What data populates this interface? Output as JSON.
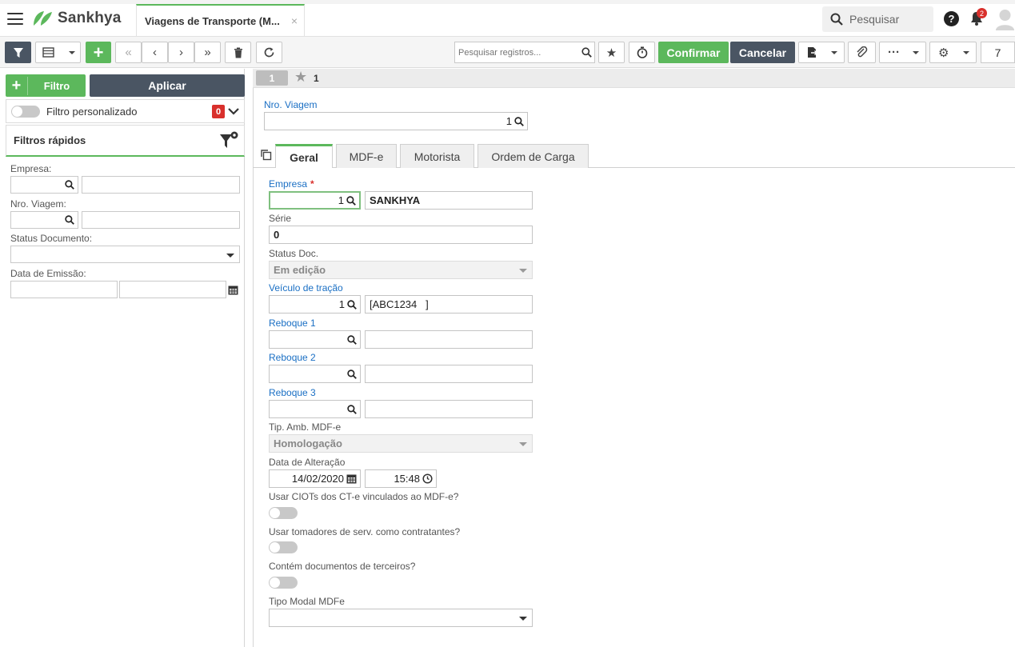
{
  "app": {
    "brand": "Sankhya",
    "tab_title": "Viagens de Transporte (M...",
    "tab_close": "×",
    "search_label": "Pesquisar",
    "notifications_count": "2",
    "help": "?"
  },
  "toolbar": {
    "search_placeholder": "Pesquisar registros...",
    "confirm_label": "Confirmar",
    "cancel_label": "Cancelar",
    "more_label": "···",
    "page_number": "7"
  },
  "left": {
    "filtro_label": "Filtro",
    "aplicar_label": "Aplicar",
    "filtro_personalizado": "Filtro personalizado",
    "filtro_count": "0",
    "filtros_rapidos": "Filtros rápidos",
    "empresa_label": "Empresa:",
    "nro_viagem_label": "Nro. Viagem:",
    "status_label": "Status Documento:",
    "data_emissao_label": "Data de Emissão:"
  },
  "record": {
    "chip": "1",
    "star_count": "1"
  },
  "form": {
    "nro_viagem_label": "Nro. Viagem",
    "nro_viagem_value": "1",
    "tabs": [
      "Geral",
      "MDF-e",
      "Motorista",
      "Ordem de Carga"
    ],
    "empresa_label": "Empresa",
    "empresa_required": "*",
    "empresa_code": "1",
    "empresa_name": "SANKHYA",
    "serie_label": "Série",
    "serie_value": "0",
    "status_doc_label": "Status Doc.",
    "status_doc_value": "Em edição",
    "veiculo_label": "Veículo de tração",
    "veiculo_code": "1",
    "veiculo_name": "[ABC1234   ]",
    "reboque1_label": "Reboque 1",
    "reboque2_label": "Reboque 2",
    "reboque3_label": "Reboque 3",
    "tip_amb_label": "Tip. Amb. MDF-e",
    "tip_amb_value": "Homologação",
    "data_alteracao_label": "Data de Alteração",
    "data_alteracao_date": "14/02/2020",
    "data_alteracao_time": "15:48",
    "usar_ciots_label": "Usar CIOTs dos CT-e vinculados ao MDF-e?",
    "usar_tomadores_label": "Usar tomadores de serv. como contratantes?",
    "contem_docs_label": "Contém documentos de terceiros?",
    "tipo_modal_label": "Tipo Modal MDFe"
  },
  "colors": {
    "green": "#5cb85c",
    "dark": "#4a5563",
    "link": "#1a6fc4",
    "badge": "#d9302c"
  }
}
